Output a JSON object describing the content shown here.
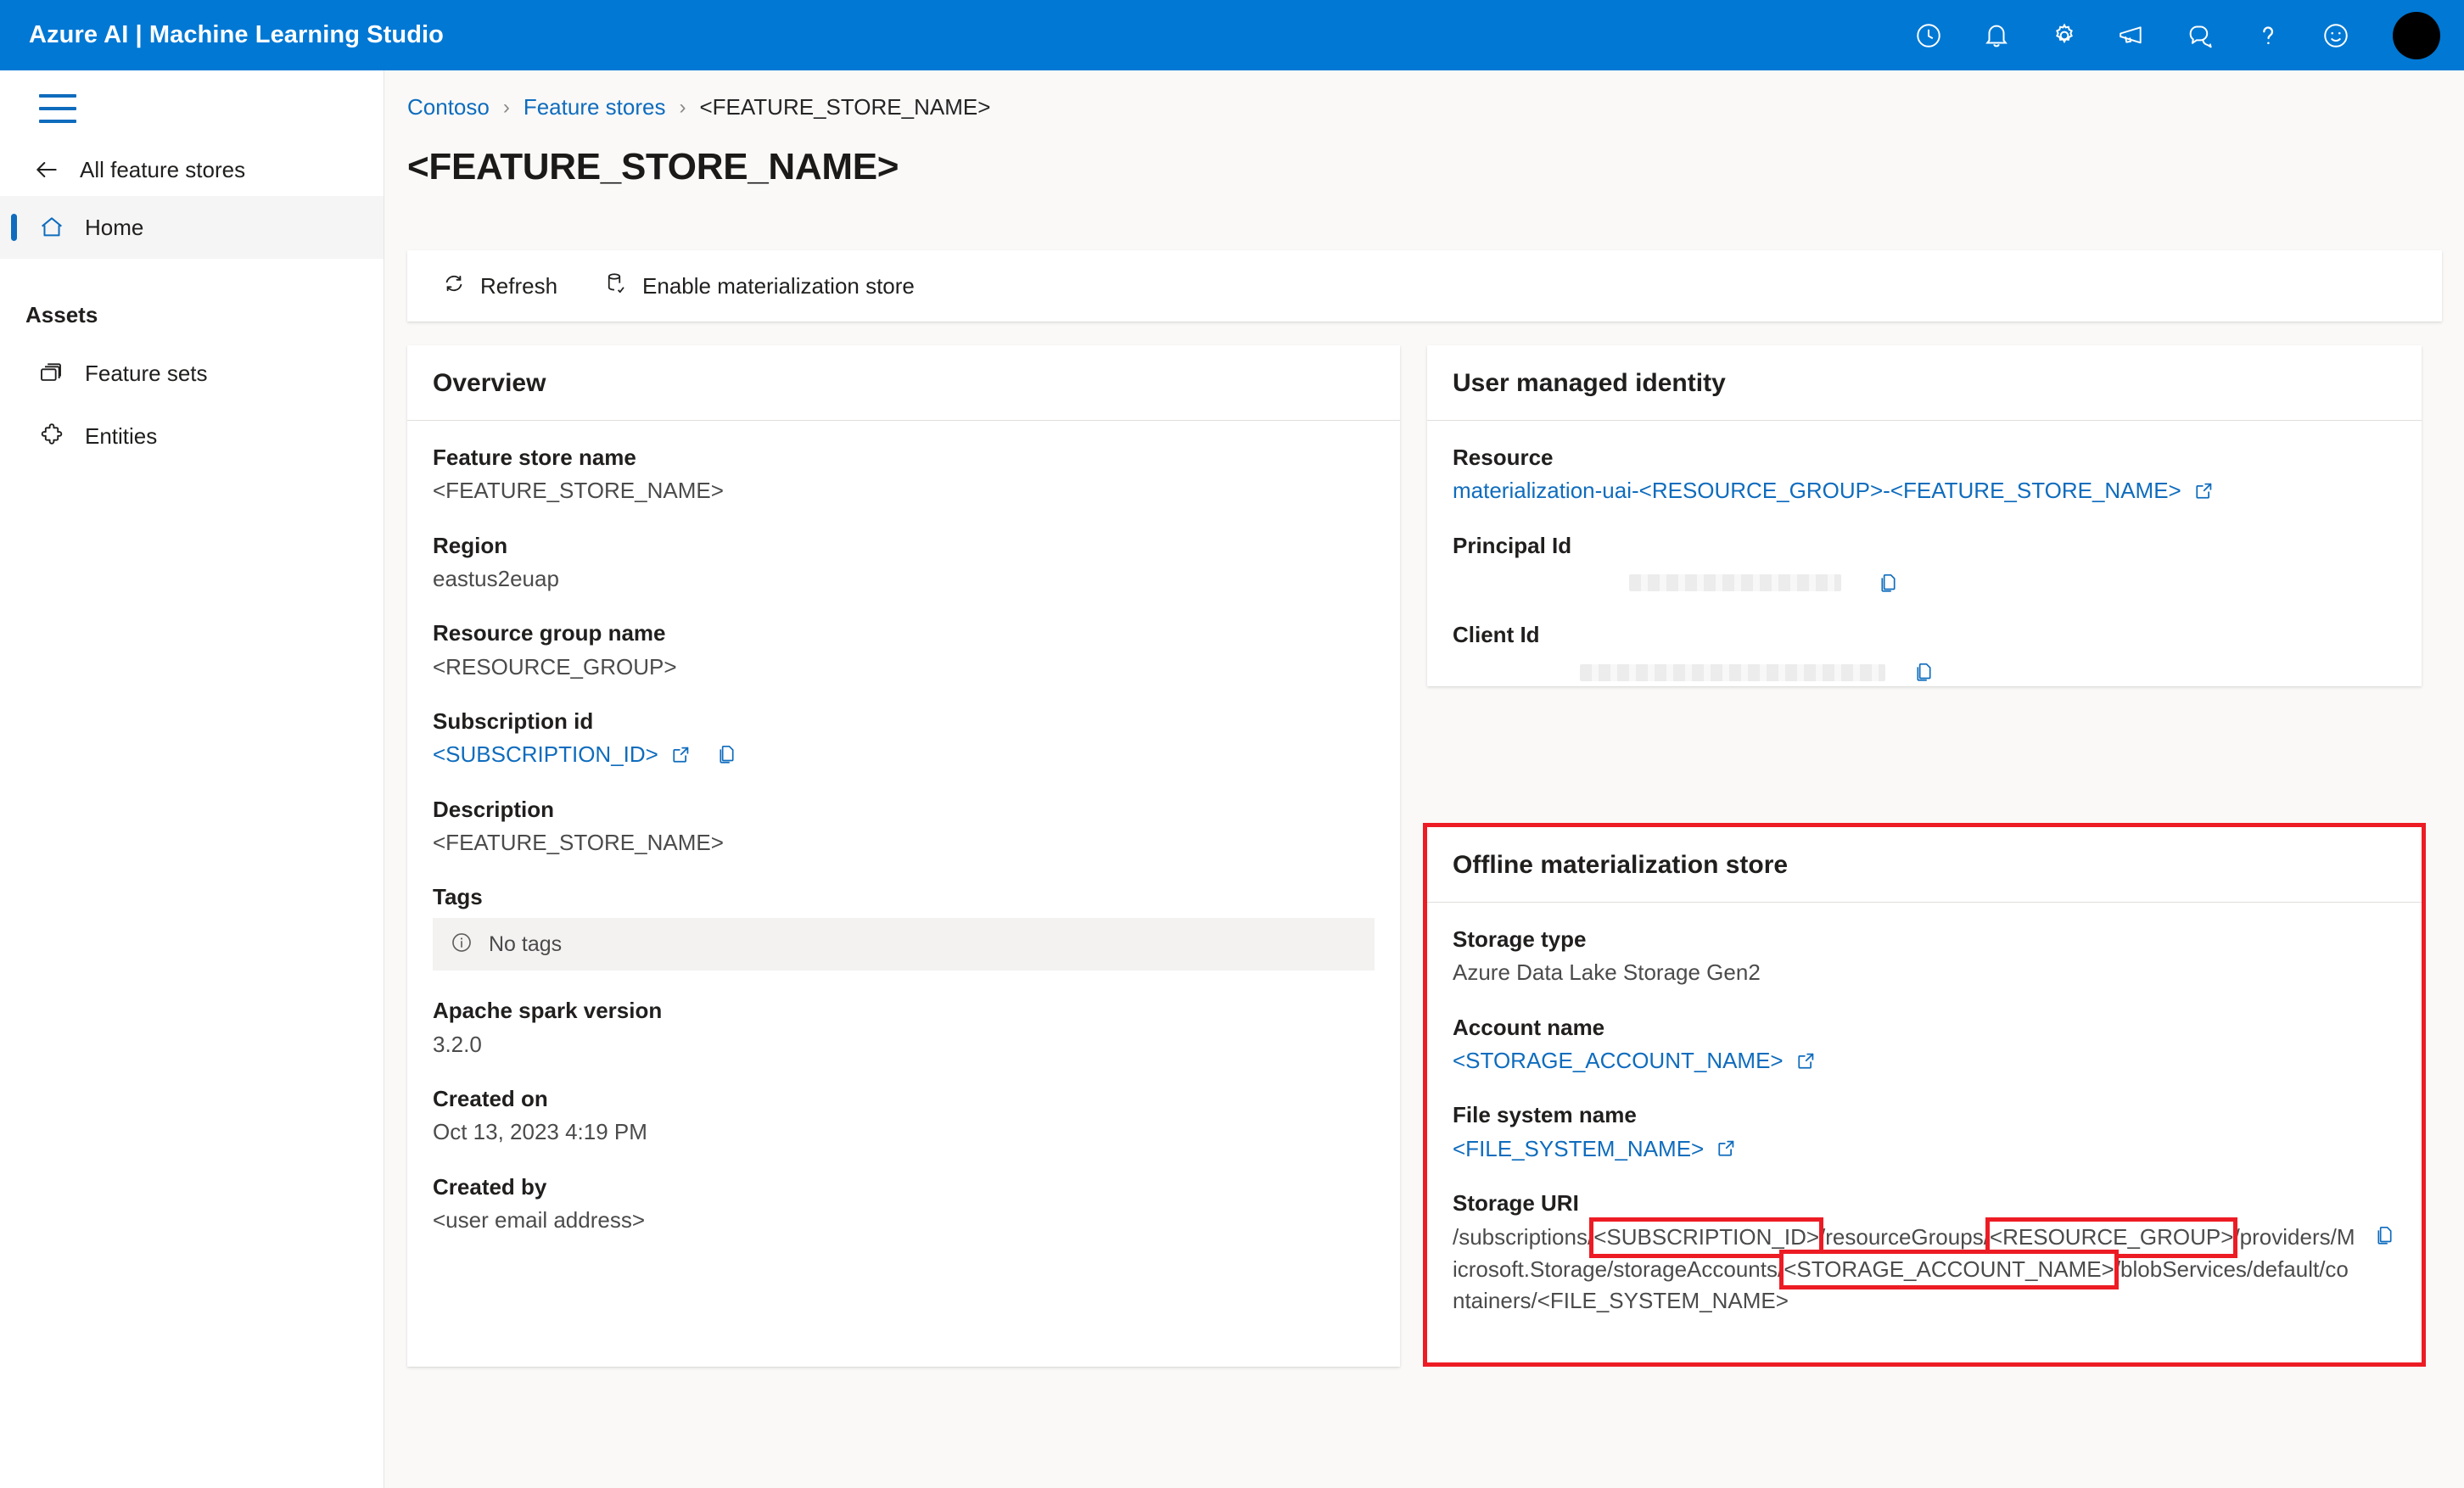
{
  "topbar": {
    "brand": "Azure AI | Machine Learning Studio",
    "icons": [
      {
        "name": "history-clock-icon",
        "label": "Recent"
      },
      {
        "name": "notification-bell-icon",
        "label": "Notifications"
      },
      {
        "name": "settings-gear-icon",
        "label": "Settings"
      },
      {
        "name": "announcements-megaphone-icon",
        "label": "What's new"
      },
      {
        "name": "feedback-chat-icon",
        "label": "Feedback"
      },
      {
        "name": "help-question-icon",
        "label": "Help"
      },
      {
        "name": "smiley-feedback-icon",
        "label": "Send a smile"
      }
    ],
    "avatar_name": "user-avatar"
  },
  "sidebar": {
    "hamburger_label": "Toggle navigation",
    "back_label": "All feature stores",
    "items": [
      {
        "label": "Home",
        "icon": "home-icon",
        "active": true
      }
    ],
    "assets_heading": "Assets",
    "asset_items": [
      {
        "label": "Feature sets",
        "icon": "feature-sets-icon"
      },
      {
        "label": "Entities",
        "icon": "entities-puzzle-icon"
      }
    ]
  },
  "breadcrumb": {
    "items": [
      {
        "label": "Contoso",
        "link": true
      },
      {
        "label": "Feature stores",
        "link": true
      },
      {
        "label": "<FEATURE_STORE_NAME>",
        "link": false
      }
    ],
    "separator": "›"
  },
  "page": {
    "title": "<FEATURE_STORE_NAME>"
  },
  "toolbar": {
    "refresh_label": "Refresh",
    "enable_label": "Enable materialization store"
  },
  "overview": {
    "header": "Overview",
    "fields": {
      "feature_store_name_label": "Feature store name",
      "feature_store_name_value": "<FEATURE_STORE_NAME>",
      "region_label": "Region",
      "region_value": "eastus2euap",
      "resource_group_label": "Resource group name",
      "resource_group_value": "<RESOURCE_GROUP>",
      "subscription_label": "Subscription id",
      "subscription_value": "<SUBSCRIPTION_ID>",
      "description_label": "Description",
      "description_value": "<FEATURE_STORE_NAME>",
      "tags_label": "Tags",
      "tags_empty": "No tags",
      "spark_label": "Apache spark version",
      "spark_value": "3.2.0",
      "created_on_label": "Created on",
      "created_on_value": "Oct 13, 2023 4:19 PM",
      "created_by_label": "Created by",
      "created_by_value": "<user email address>"
    }
  },
  "identity": {
    "header": "User managed identity",
    "resource_label": "Resource",
    "resource_value": "materialization-uai-<RESOURCE_GROUP>-<FEATURE_STORE_NAME>",
    "principal_label": "Principal Id",
    "principal_value": "",
    "client_label": "Client Id",
    "client_value": ""
  },
  "offline_store": {
    "header": "Offline materialization store",
    "storage_type_label": "Storage type",
    "storage_type_value": "Azure Data Lake Storage Gen2",
    "account_label": "Account name",
    "account_value": "<STORAGE_ACCOUNT_NAME>",
    "filesystem_label": "File system name",
    "filesystem_value": "<FILE_SYSTEM_NAME>",
    "uri_label": "Storage URI",
    "uri_parts": {
      "p1": "/subscriptions/",
      "p2": "<SUBSCRIPTION_ID>",
      "p3": "/resourceGroups/",
      "p4": "<RESOURCE_GROUP>",
      "p5": "/providers/Microsoft.Storage/storageAccounts/",
      "p6": "<STORAGE_ACCOUNT_NAME>",
      "p7": "/blobServices/default/containers/<FILE_SYSTEM_NAME>"
    }
  },
  "colors": {
    "header_blue": "#0078D4",
    "link_blue": "#0F6CBD",
    "annotation_red": "#ED1C24",
    "page_bg": "#FAF9F8",
    "card_bg": "#FFFFFF",
    "tag_bar_bg": "#F3F2F1"
  }
}
